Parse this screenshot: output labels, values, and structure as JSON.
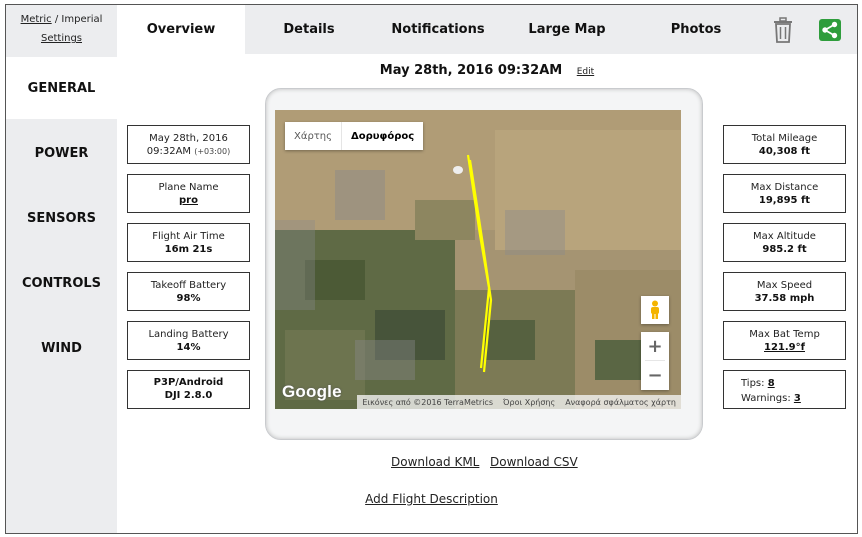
{
  "units": {
    "metric": "Metric",
    "separator": " / ",
    "imperial": "Imperial",
    "settings": "Settings"
  },
  "sidebar": {
    "items": [
      {
        "label": "GENERAL"
      },
      {
        "label": "POWER"
      },
      {
        "label": "SENSORS"
      },
      {
        "label": "CONTROLS"
      },
      {
        "label": "WIND"
      }
    ],
    "active": "GENERAL"
  },
  "tabs": [
    {
      "label": "Overview"
    },
    {
      "label": "Details"
    },
    {
      "label": "Notifications"
    },
    {
      "label": "Large Map"
    },
    {
      "label": "Photos"
    }
  ],
  "active_tab": "Overview",
  "toolbar": {
    "trash_icon": "trash-icon",
    "share_icon": "share-icon",
    "share_color": "#2e9d3c"
  },
  "header": {
    "datetime": "May 28th, 2016 09:32AM",
    "edit": "Edit"
  },
  "left_stats": {
    "date": {
      "line1": "May 28th, 2016",
      "line2": "09:32AM",
      "tz": "(+03:00)"
    },
    "plane": {
      "label": "Plane Name",
      "value": "pro"
    },
    "air_time": {
      "label": "Flight Air Time",
      "value": "16m 21s"
    },
    "takeoff_battery": {
      "label": "Takeoff Battery",
      "value": "98%"
    },
    "landing_battery": {
      "label": "Landing Battery",
      "value": "14%"
    },
    "app": {
      "line1": "P3P/Android",
      "line2": "DJI 2.8.0"
    }
  },
  "right_stats": {
    "mileage": {
      "label": "Total Mileage",
      "value": "40,308 ft"
    },
    "max_distance": {
      "label": "Max Distance",
      "value": "19,895 ft"
    },
    "max_altitude": {
      "label": "Max Altitude",
      "value": "985.2 ft"
    },
    "max_speed": {
      "label": "Max Speed",
      "value": "37.58 mph"
    },
    "max_bat_temp": {
      "label": "Max Bat Temp",
      "value": "121.9°f"
    },
    "tips": {
      "tips_label": "Tips:",
      "tips_value": "8",
      "warnings_label": "Warnings:",
      "warnings_value": "3"
    }
  },
  "map": {
    "type_map": "Χάρτης",
    "type_satellite": "Δορυφόρος",
    "logo": "Google",
    "attribution": "Εικόνες από ©2016 TerraMetrics",
    "terms": "Όροι Χρήσης",
    "report": "Αναφορά σφάλματος χάρτη",
    "zoom_in": "+",
    "zoom_out": "−",
    "path_color": "#ffff00"
  },
  "downloads": {
    "kml": "Download KML",
    "csv": "Download CSV"
  },
  "add_description": "Add Flight Description"
}
